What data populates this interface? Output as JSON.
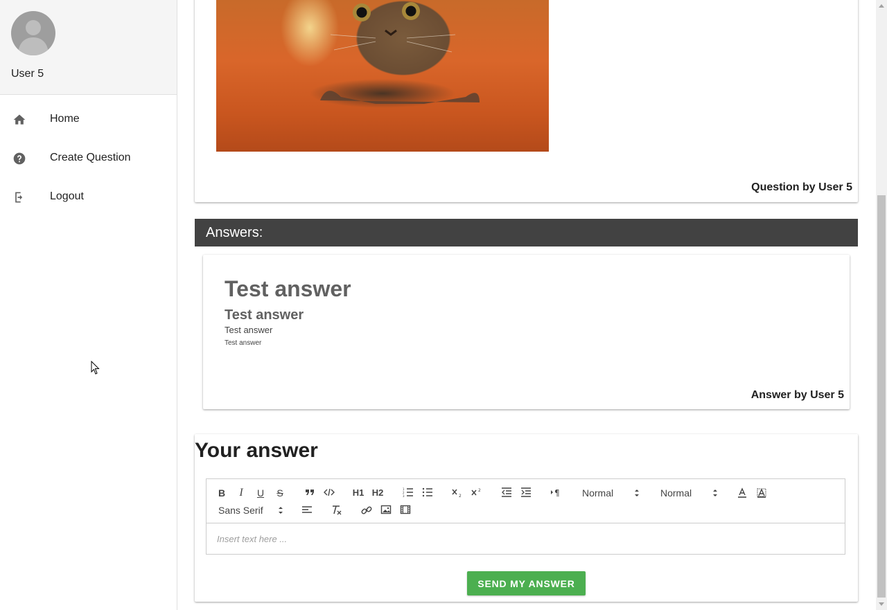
{
  "sidebar": {
    "user_name": "User 5",
    "items": [
      {
        "label": "Home",
        "icon": "home-icon"
      },
      {
        "label": "Create Question",
        "icon": "help-circle-icon"
      },
      {
        "label": "Logout",
        "icon": "logout-icon"
      }
    ]
  },
  "question": {
    "image_alt": "cat",
    "footer": "Question by User 5"
  },
  "answers": {
    "header": "Answers:",
    "items": [
      {
        "lines": [
          "Test answer",
          "Test answer",
          "Test answer",
          "Test answer"
        ],
        "footer": "Answer by User 5"
      }
    ]
  },
  "your_answer": {
    "title": "Your answer",
    "toolbar": {
      "bold": "B",
      "italic": "I",
      "underline": "U",
      "strike": "S",
      "header_1": "H1",
      "header_2": "H2",
      "size_picker": "Normal",
      "header_picker": "Normal",
      "font_picker": "Sans Serif"
    },
    "editor_placeholder": "Insert text here ...",
    "send_label": "SEND MY ANSWER"
  },
  "colors": {
    "accent": "#4caf50",
    "answers_header_bg": "#424242",
    "profile_bg": "#f5f5f5"
  }
}
